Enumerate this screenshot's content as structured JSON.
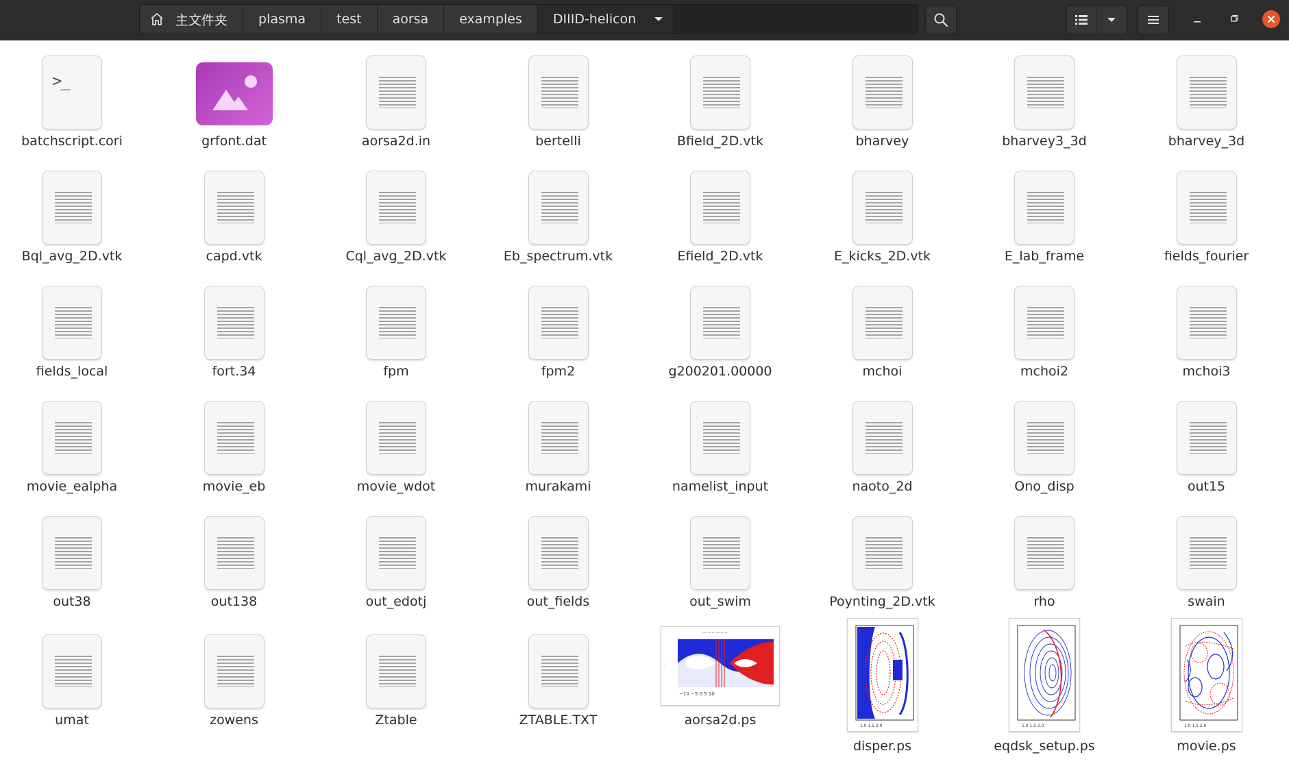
{
  "path": {
    "home_label": "主文件夹",
    "segments": [
      "plasma",
      "test",
      "aorsa",
      "examples"
    ],
    "current": "DIIID-helicon"
  },
  "toolbar": {
    "search_icon": "search-icon",
    "view_icon": "list-view-icon",
    "view_options_icon": "chevron-down-icon",
    "menu_icon": "hamburger-menu-icon"
  },
  "window_controls": {
    "minimize": "minimize-icon",
    "maximize": "maximize-icon",
    "close": "close-icon",
    "close_color": "#e9552a"
  },
  "files": [
    {
      "name": "batchscript.cori",
      "icon": "script"
    },
    {
      "name": "grfont.dat",
      "icon": "image"
    },
    {
      "name": "aorsa2d.in",
      "icon": "text"
    },
    {
      "name": "bertelli",
      "icon": "text"
    },
    {
      "name": "Bfield_2D.vtk",
      "icon": "text"
    },
    {
      "name": "bharvey",
      "icon": "text"
    },
    {
      "name": "bharvey3_3d",
      "icon": "text"
    },
    {
      "name": "bharvey_3d",
      "icon": "text"
    },
    {
      "name": "Bql_avg_2D.vtk",
      "icon": "text"
    },
    {
      "name": "capd.vtk",
      "icon": "text"
    },
    {
      "name": "Cql_avg_2D.vtk",
      "icon": "text"
    },
    {
      "name": "Eb_spectrum.vtk",
      "icon": "text"
    },
    {
      "name": "Efield_2D.vtk",
      "icon": "text"
    },
    {
      "name": "E_kicks_2D.vtk",
      "icon": "text"
    },
    {
      "name": "E_lab_frame",
      "icon": "text"
    },
    {
      "name": "fields_fourier",
      "icon": "text"
    },
    {
      "name": "fields_local",
      "icon": "text"
    },
    {
      "name": "fort.34",
      "icon": "text"
    },
    {
      "name": "fpm",
      "icon": "text"
    },
    {
      "name": "fpm2",
      "icon": "text"
    },
    {
      "name": "g200201.00000",
      "icon": "text"
    },
    {
      "name": "mchoi",
      "icon": "text"
    },
    {
      "name": "mchoi2",
      "icon": "text"
    },
    {
      "name": "mchoi3",
      "icon": "text"
    },
    {
      "name": "movie_ealpha",
      "icon": "text"
    },
    {
      "name": "movie_eb",
      "icon": "text"
    },
    {
      "name": "movie_wdot",
      "icon": "text"
    },
    {
      "name": "murakami",
      "icon": "text"
    },
    {
      "name": "namelist_input",
      "icon": "text"
    },
    {
      "name": "naoto_2d",
      "icon": "text"
    },
    {
      "name": "Ono_disp",
      "icon": "text"
    },
    {
      "name": "out15",
      "icon": "text"
    },
    {
      "name": "out38",
      "icon": "text"
    },
    {
      "name": "out138",
      "icon": "text"
    },
    {
      "name": "out_edotj",
      "icon": "text"
    },
    {
      "name": "out_fields",
      "icon": "text"
    },
    {
      "name": "out_swim",
      "icon": "text"
    },
    {
      "name": "Poynting_2D.vtk",
      "icon": "text"
    },
    {
      "name": "rho",
      "icon": "text"
    },
    {
      "name": "swain",
      "icon": "text"
    },
    {
      "name": "umat",
      "icon": "text"
    },
    {
      "name": "zowens",
      "icon": "text"
    },
    {
      "name": "Ztable",
      "icon": "text"
    },
    {
      "name": "ZTABLE.TXT",
      "icon": "text"
    },
    {
      "name": "aorsa2d.ps",
      "icon": "thumb-landscape"
    },
    {
      "name": "disper.ps",
      "icon": "thumb-disper"
    },
    {
      "name": "eqdsk_setup.ps",
      "icon": "thumb-eqdsk"
    },
    {
      "name": "movie.ps",
      "icon": "thumb-movie"
    }
  ],
  "colors": {
    "header_bg": "#2c2c2c",
    "image_icon": "#b64bc3",
    "plot_blue": "#1f2bd8",
    "plot_red": "#e02020"
  }
}
